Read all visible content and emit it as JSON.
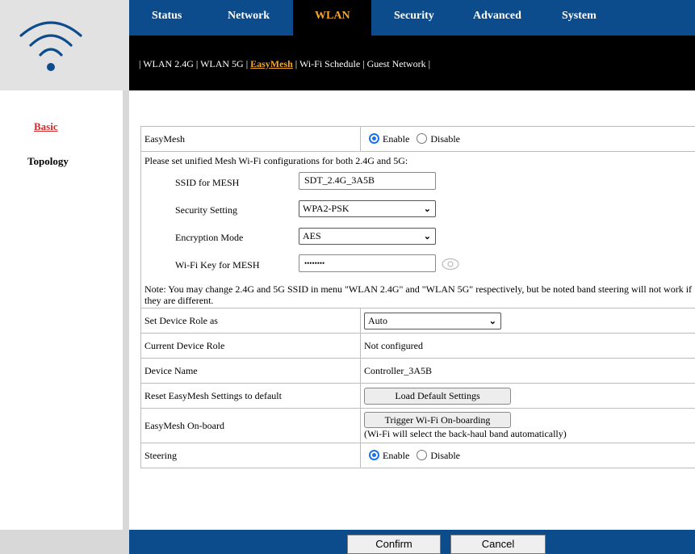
{
  "logo": {
    "icon": "wifi-icon"
  },
  "nav": {
    "items": [
      {
        "label": "Status"
      },
      {
        "label": "Network"
      },
      {
        "label": "WLAN",
        "active": true
      },
      {
        "label": "Security"
      },
      {
        "label": "Advanced"
      },
      {
        "label": "System"
      }
    ]
  },
  "subnav": {
    "items": [
      {
        "label": "WLAN 2.4G"
      },
      {
        "label": "WLAN 5G"
      },
      {
        "label": "EasyMesh",
        "active": true
      },
      {
        "label": "Wi-Fi Schedule"
      },
      {
        "label": "Guest Network"
      }
    ],
    "separator": "|"
  },
  "sidebar": {
    "items": [
      {
        "label": "Basic",
        "active": true
      },
      {
        "label": "Topology"
      }
    ]
  },
  "form": {
    "easymesh_label": "EasyMesh",
    "enable_label": "Enable",
    "disable_label": "Disable",
    "easymesh_enabled": true,
    "note_unified": "Please set unified Mesh Wi-Fi configurations for both 2.4G and 5G:",
    "ssid_label": "SSID for MESH",
    "ssid_value": "SDT_2.4G_3A5B",
    "security_label": "Security Setting",
    "security_value": "WPA2-PSK",
    "encryption_label": "Encryption Mode",
    "encryption_value": "AES",
    "key_label": "Wi-Fi Key for MESH",
    "key_value": "••••••••",
    "note_ssid": "Note: You may change 2.4G and 5G SSID in menu \"WLAN 2.4G\" and \"WLAN 5G\" respectively, but be noted band steering will not work if they are different.",
    "role_label": "Set Device Role as",
    "role_value": "Auto",
    "current_role_label": "Current Device Role",
    "current_role_value": "Not configured",
    "device_name_label": "Device Name",
    "device_name_value": "Controller_3A5B",
    "reset_label": "Reset EasyMesh Settings to default",
    "reset_button": "Load Default Settings",
    "onboard_label": "EasyMesh On-board",
    "onboard_button": "Trigger Wi-Fi On-boarding",
    "onboard_note": "(Wi-Fi will select the back-haul band automatically)",
    "steering_label": "Steering",
    "steering_enabled": true
  },
  "footer": {
    "confirm": "Confirm",
    "cancel": "Cancel"
  },
  "colors": {
    "nav_bg": "#0c4c8c",
    "active_nav": "#f5a623",
    "active_side": "#d42a2a"
  }
}
